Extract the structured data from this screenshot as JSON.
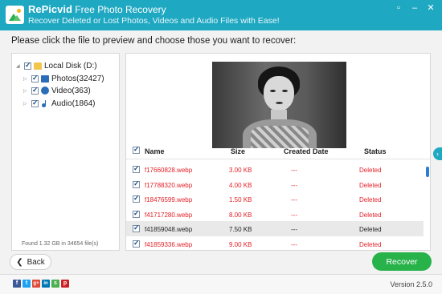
{
  "header": {
    "brand": "RePicvid",
    "title": "Free Photo Recovery",
    "subtitle": "Recover Deleted or Lost Photos, Videos and Audio Files with Ease!"
  },
  "instruction": "Please click the file to preview and choose those you want to recover:",
  "tree": {
    "root": "Local Disk (D:)",
    "items": [
      {
        "label": "Photos(32427)",
        "icon": "image-icon"
      },
      {
        "label": "Video(363)",
        "icon": "video-icon"
      },
      {
        "label": "Audio(1864)",
        "icon": "music-icon"
      }
    ],
    "found": "Found 1.32 GB in 34654 file(s)"
  },
  "table": {
    "headers": {
      "name": "Name",
      "size": "Size",
      "date": "Created Date",
      "status": "Status"
    },
    "rows": [
      {
        "name": "f17660828.webp",
        "size": "3.00 KB",
        "date": "---",
        "status": "Deleted",
        "selected": false
      },
      {
        "name": "f17788320.webp",
        "size": "4.00 KB",
        "date": "---",
        "status": "Deleted",
        "selected": false
      },
      {
        "name": "f18476599.webp",
        "size": "1.50 KB",
        "date": "---",
        "status": "Deleted",
        "selected": false
      },
      {
        "name": "f41717280.webp",
        "size": "8.00 KB",
        "date": "---",
        "status": "Deleted",
        "selected": false
      },
      {
        "name": "f41859048.webp",
        "size": "7.50 KB",
        "date": "---",
        "status": "Deleted",
        "selected": true
      },
      {
        "name": "f41859336.webp",
        "size": "9.00 KB",
        "date": "---",
        "status": "Deleted",
        "selected": false
      }
    ]
  },
  "buttons": {
    "back": "Back",
    "recover": "Recover"
  },
  "footer": {
    "social": [
      {
        "icon": "facebook-icon",
        "glyph": "f",
        "color": "#3b5998"
      },
      {
        "icon": "twitter-icon",
        "glyph": "t",
        "color": "#1da1f2"
      },
      {
        "icon": "google-plus-icon",
        "glyph": "g+",
        "color": "#dd4b39"
      },
      {
        "icon": "linkedin-icon",
        "glyph": "in",
        "color": "#0077b5"
      },
      {
        "icon": "stumbleupon-icon",
        "glyph": "s",
        "color": "#4caf50"
      },
      {
        "icon": "pinterest-icon",
        "glyph": "p",
        "color": "#cb2027"
      }
    ],
    "version": "Version 2.5.0"
  },
  "colors": {
    "accent": "#1fa8c2",
    "recover": "#27b24a",
    "deleted": "#e21f26"
  }
}
